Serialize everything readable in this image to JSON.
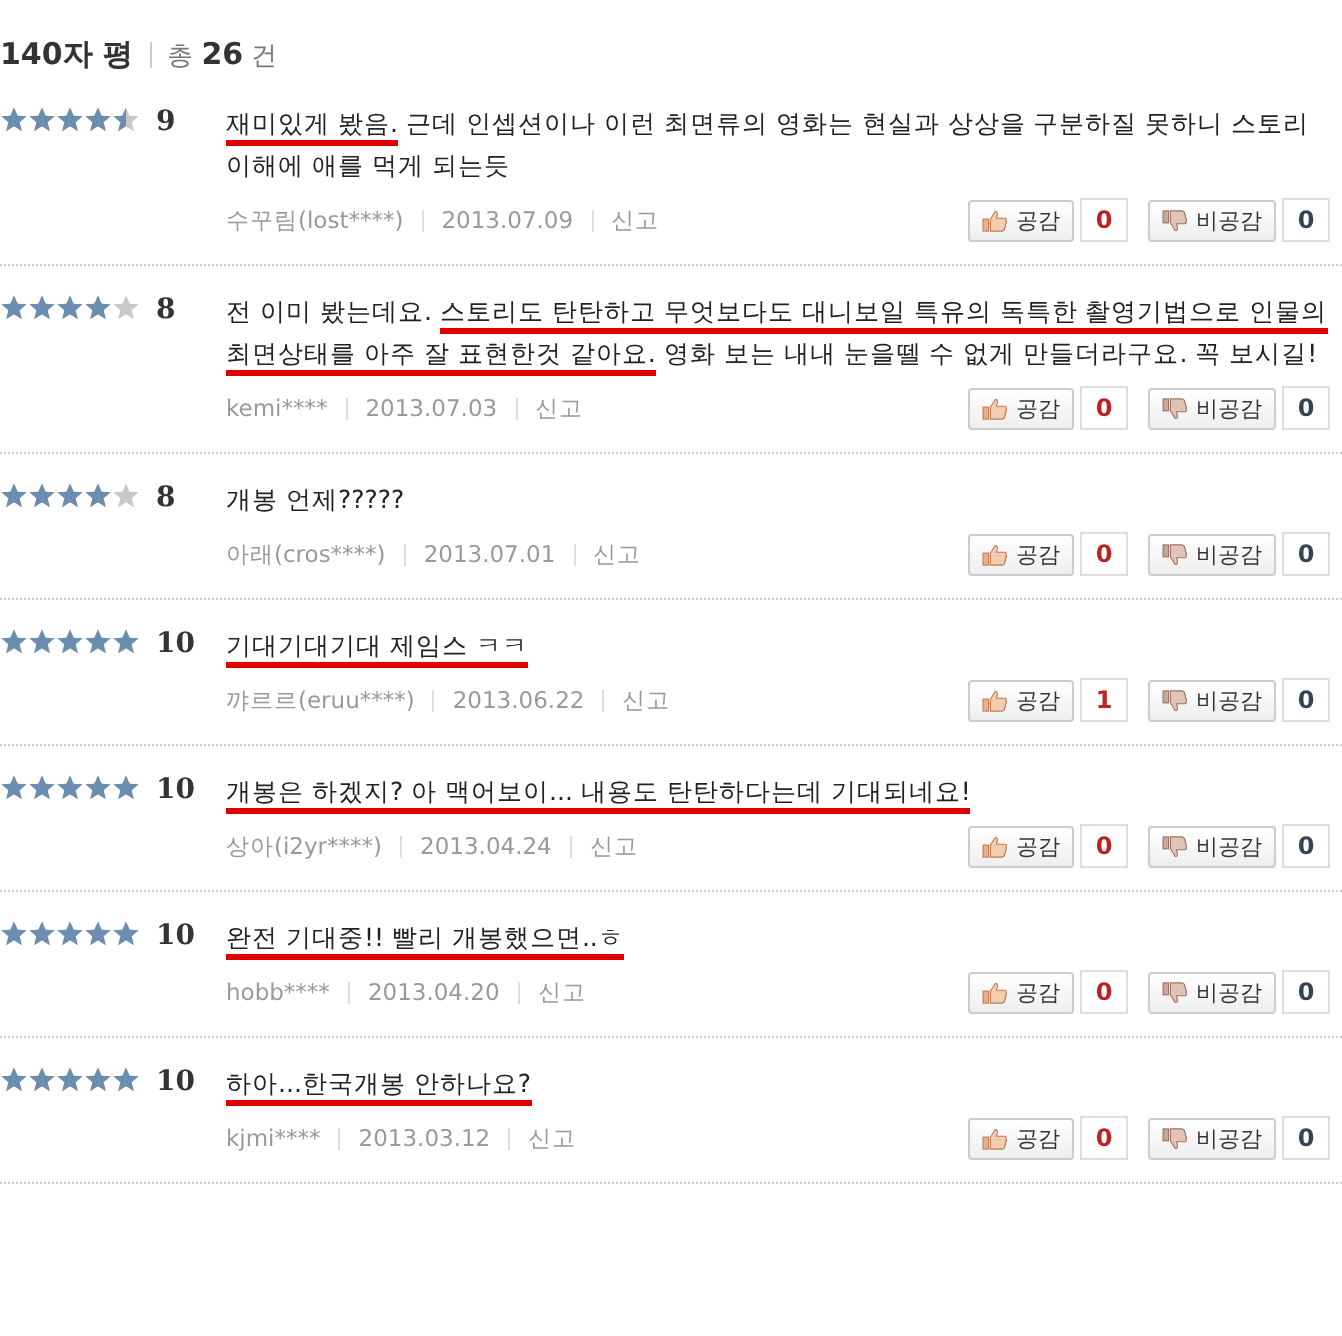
{
  "header": {
    "title": "140자 평",
    "total_prefix": "총",
    "total": "26",
    "total_suffix": "건"
  },
  "reviews": [
    {
      "stars": 4.5,
      "score": "9",
      "segments": [
        {
          "text": "재미있게 봤음.",
          "underlined": true
        },
        {
          "text": " 근데 인셉션이나 이런 최면류의 영화는 현실과 상상을 구분하질 못하니 스토리 이해에 애를 먹게 되는듯",
          "underlined": false
        }
      ],
      "author": "수꾸림(lost****)",
      "date": "2013.07.09",
      "report": "신고",
      "like_label": "공감",
      "likes": "0",
      "dislike_label": "비공감",
      "dislikes": "0"
    },
    {
      "stars": 4,
      "score": "8",
      "segments": [
        {
          "text": "전 이미 봤는데요. ",
          "underlined": false
        },
        {
          "text": "스토리도 탄탄하고 무엇보다도 대니보일 특유의 독특한 촬영기법으로 인물의 최면상태를 아주 잘 표현한것 같아요.",
          "underlined": true
        },
        {
          "text": " 영화 보는 내내 눈을뗄 수 없게 만들더라구요. 꼭 보시길!",
          "underlined": false
        }
      ],
      "author": "kemi****",
      "date": "2013.07.03",
      "report": "신고",
      "like_label": "공감",
      "likes": "0",
      "dislike_label": "비공감",
      "dislikes": "0"
    },
    {
      "stars": 4,
      "score": "8",
      "segments": [
        {
          "text": "개봉 언제?????",
          "underlined": false
        }
      ],
      "author": "아래(cros****)",
      "date": "2013.07.01",
      "report": "신고",
      "like_label": "공감",
      "likes": "0",
      "dislike_label": "비공감",
      "dislikes": "0"
    },
    {
      "stars": 5,
      "score": "10",
      "segments": [
        {
          "text": "기대기대기대 제임스 ㅋㅋ",
          "underlined": true
        }
      ],
      "author": "꺄르르(eruu****)",
      "date": "2013.06.22",
      "report": "신고",
      "like_label": "공감",
      "likes": "1",
      "dislike_label": "비공감",
      "dislikes": "0"
    },
    {
      "stars": 5,
      "score": "10",
      "segments": [
        {
          "text": "개봉은 하겠지? 아 맥어보이... 내용도 탄탄하다는데 기대되네요!",
          "underlined": true
        }
      ],
      "author": "상아(i2yr****)",
      "date": "2013.04.24",
      "report": "신고",
      "like_label": "공감",
      "likes": "0",
      "dislike_label": "비공감",
      "dislikes": "0"
    },
    {
      "stars": 5,
      "score": "10",
      "segments": [
        {
          "text": "완전 기대중!! 빨리 개봉했으면..ㅎ",
          "underlined": true
        }
      ],
      "author": "hobb****",
      "date": "2013.04.20",
      "report": "신고",
      "like_label": "공감",
      "likes": "0",
      "dislike_label": "비공감",
      "dislikes": "0"
    },
    {
      "stars": 5,
      "score": "10",
      "segments": [
        {
          "text": "하아...한국개봉 안하나요?",
          "underlined": true
        }
      ],
      "author": "kjmi****",
      "date": "2013.03.12",
      "report": "신고",
      "like_label": "공감",
      "likes": "0",
      "dislike_label": "비공감",
      "dislikes": "0"
    }
  ]
}
